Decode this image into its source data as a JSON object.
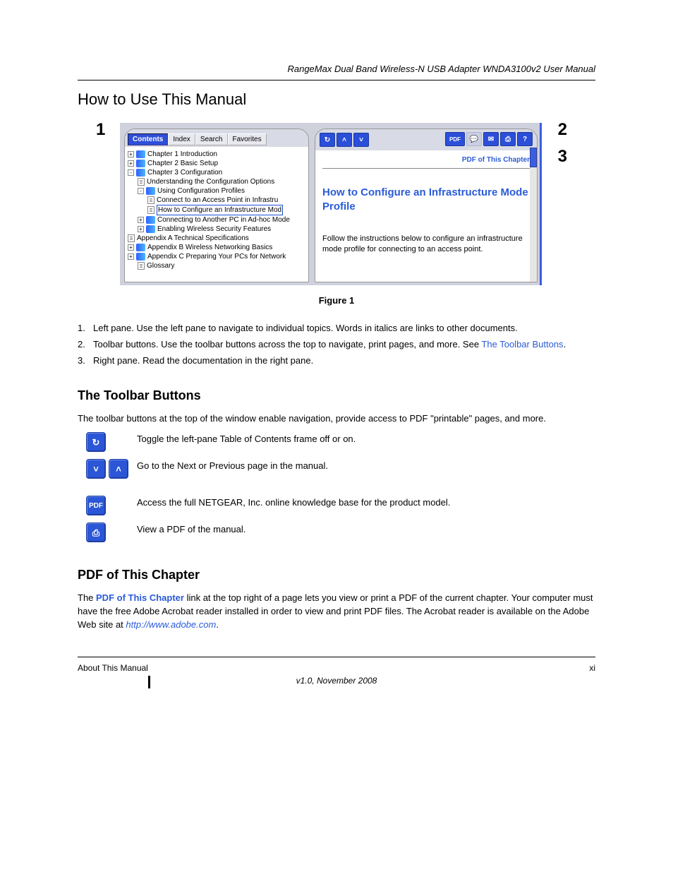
{
  "running_header": "RangeMax Dual Band Wireless-N USB Adapter WNDA3100v2 User Manual",
  "section_title": "How to Use This Manual",
  "figure": {
    "callouts": {
      "one": "1",
      "two": "2",
      "three": "3"
    },
    "tabs": {
      "contents": "Contents",
      "index": "Index",
      "search": "Search",
      "favorites": "Favorites"
    },
    "tree": {
      "ch1": "Chapter 1  Introduction",
      "ch2": "Chapter 2  Basic Setup",
      "ch3": "Chapter 3  Configuration",
      "ch3a": "Understanding the Configuration Options",
      "ch3b": "Using Configuration Profiles",
      "ch3b1": "Connect to an Access Point in Infrastru",
      "ch3b2": "How to Configure an Infrastructure Mod",
      "ch3c": "Connecting to Another PC in Ad-hoc Mode",
      "ch3d": "Enabling Wireless Security Features",
      "appa": "Appendix A  Technical Specifications",
      "appb": "Appendix B  Wireless Networking Basics",
      "appc": "Appendix C  Preparing Your PCs for Network",
      "glossary": "Glossary"
    },
    "toolbar_icons": {
      "refresh": "↻",
      "up": "˄",
      "down": "˅",
      "pdf": "PDF",
      "chat": "💬",
      "mail": "✉",
      "print": "⎙",
      "help": "?"
    },
    "pdf_link": "PDF of This Chapter",
    "cap_title": "How to Configure an Infrastructure Mode Profile",
    "cap_body": "Follow the instructions below to configure an infrastructure mode profile for connecting to an access point."
  },
  "figure_caption_label": "Figure 1",
  "numlist": {
    "n1": "Left pane. Use the left pane to navigate to individual topics. Words in italics are links to other documents.",
    "n2": "Toolbar buttons. Use the toolbar buttons across the top to navigate, print pages, and more. See ",
    "n2_link": "The Toolbar Buttons",
    "n2_tail": ".",
    "n3": "Right pane. Read the documentation in the right pane."
  },
  "toolbar_h": "The Toolbar Buttons",
  "toolbar_intro": "The toolbar buttons at the top of the window enable navigation, provide access to PDF \"printable\" pages, and more.",
  "btn_rows": {
    "refresh": "Toggle the left-pane Table of Contents frame off or on.",
    "nav": "Go to the Next or Previous page in the manual.",
    "pdf": "Access the full NETGEAR, Inc. online knowledge base for the product model.",
    "print": "View a PDF of the manual."
  },
  "pdf_link_sect": {
    "p1_pre": "The ",
    "link": "PDF of This Chapter",
    "p1_post": " link at the top right of a page lets you view or print a PDF of the current chapter. Your computer must have the free Adobe Acrobat reader installed in order to view and print PDF files. The Acrobat reader is available on the Adobe Web site at ",
    "adobe_url": "http://www.adobe.com",
    "p1_end": "."
  },
  "footer": {
    "left": "About This Manual",
    "right_page": "xi",
    "version": "v1.0, November 2008"
  }
}
